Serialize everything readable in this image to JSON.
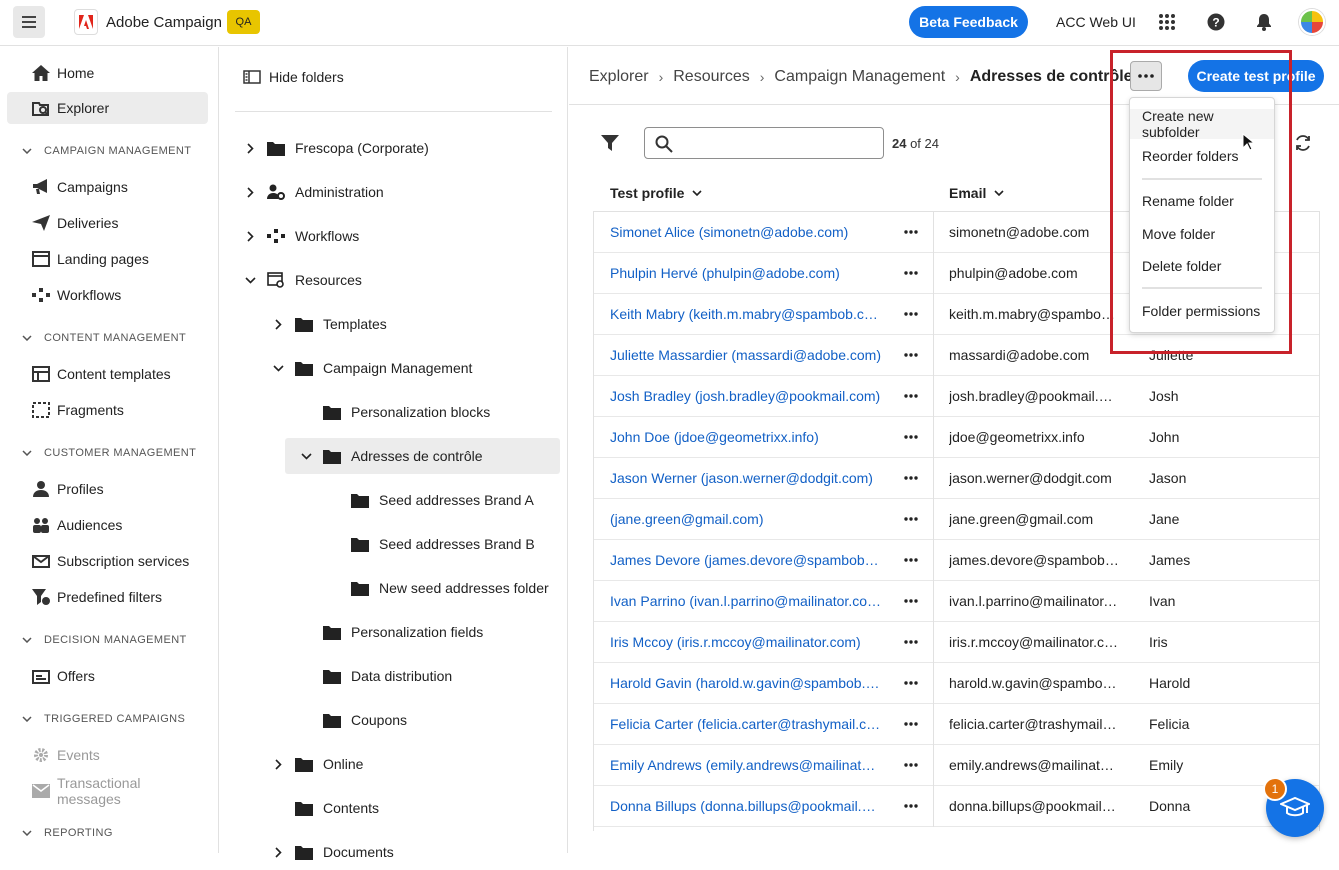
{
  "topbar": {
    "app_name": "Adobe Campaign",
    "env_badge": "QA",
    "beta_label": "Beta Feedback",
    "acc_web_label": "ACC Web UI",
    "icons": [
      "menu-icon",
      "adobe-logo-icon",
      "apps-grid-icon",
      "help-icon",
      "notifications-icon",
      "avatar"
    ]
  },
  "nav": {
    "home": "Home",
    "explorer": "Explorer",
    "sec_campaign": "CAMPAIGN MANAGEMENT",
    "campaigns": "Campaigns",
    "deliveries": "Deliveries",
    "landing_pages": "Landing pages",
    "workflows": "Workflows",
    "sec_content": "CONTENT MANAGEMENT",
    "content_templates": "Content templates",
    "fragments": "Fragments",
    "sec_customer": "CUSTOMER MANAGEMENT",
    "profiles": "Profiles",
    "audiences": "Audiences",
    "subscription_services": "Subscription services",
    "predefined_filters": "Predefined filters",
    "sec_decision": "DECISION MANAGEMENT",
    "offers": "Offers",
    "sec_triggered": "TRIGGERED CAMPAIGNS",
    "events": "Events",
    "transactional_messages": "Transactional messages",
    "sec_reporting": "REPORTING"
  },
  "tree": {
    "hide_folders": "Hide folders",
    "nodes": {
      "frescopa": "Frescopa (Corporate)",
      "administration": "Administration",
      "workflows": "Workflows",
      "resources": "Resources",
      "templates": "Templates",
      "campaign_management": "Campaign Management",
      "personalization_blocks": "Personalization blocks",
      "adresses": "Adresses de contrôle",
      "seed_a": "Seed addresses Brand A",
      "seed_b": "Seed addresses Brand B",
      "new_seed": "New seed addresses folder",
      "personalization_fields": "Personalization fields",
      "data_distribution": "Data distribution",
      "coupons": "Coupons",
      "online": "Online",
      "contents": "Contents",
      "documents": "Documents"
    }
  },
  "breadcrumb": {
    "items": [
      "Explorer",
      "Resources",
      "Campaign Management"
    ],
    "current": "Adresses de contrôle"
  },
  "actions": {
    "create_label": "Create test profile"
  },
  "search": {
    "placeholder": "",
    "count_bold": "24",
    "count_rest": " of 24"
  },
  "table": {
    "col_profile": "Test profile",
    "col_email": "Email",
    "rows": [
      {
        "profile": "Simonet Alice (simonetn@adobe.com)",
        "email": "simonetn@adobe.com",
        "first": ""
      },
      {
        "profile": "Phulpin Hervé (phulpin@adobe.com)",
        "email": "phulpin@adobe.com",
        "first": ""
      },
      {
        "profile": "Keith Mabry (keith.m.mabry@spambob.com)",
        "email": "keith.m.mabry@spambob.c...",
        "first": ""
      },
      {
        "profile": "Juliette Massardier (massardi@adobe.com)",
        "email": "massardi@adobe.com",
        "first": "Juliette"
      },
      {
        "profile": "Josh Bradley (josh.bradley@pookmail.com)",
        "email": "josh.bradley@pookmail.com",
        "first": "Josh"
      },
      {
        "profile": "John Doe (jdoe@geometrixx.info)",
        "email": "jdoe@geometrixx.info",
        "first": "John"
      },
      {
        "profile": "Jason Werner (jason.werner@dodgit.com)",
        "email": "jason.werner@dodgit.com",
        "first": "Jason"
      },
      {
        "profile": "(jane.green@gmail.com)",
        "email": "jane.green@gmail.com",
        "first": "Jane"
      },
      {
        "profile": "James Devore (james.devore@spambob.com)",
        "email": "james.devore@spambob.com",
        "first": "James"
      },
      {
        "profile": "Ivan Parrino (ivan.l.parrino@mailinator.com)",
        "email": "ivan.l.parrino@mailinator.c...",
        "first": "Ivan"
      },
      {
        "profile": "Iris Mccoy (iris.r.mccoy@mailinator.com)",
        "email": "iris.r.mccoy@mailinator.com",
        "first": "Iris"
      },
      {
        "profile": "Harold Gavin (harold.w.gavin@spambob.com)",
        "email": "harold.w.gavin@spambob.c...",
        "first": "Harold"
      },
      {
        "profile": "Felicia Carter (felicia.carter@trashymail.com)",
        "email": "felicia.carter@trashymail.com",
        "first": "Felicia"
      },
      {
        "profile": "Emily Andrews (emily.andrews@mailinator.c...",
        "email": "emily.andrews@mailinator....",
        "first": "Emily"
      },
      {
        "profile": "Donna Billups (donna.billups@pookmail.com)",
        "email": "donna.billups@pookmail.c...",
        "first": "Donna"
      }
    ]
  },
  "context_menu": {
    "items": [
      "Create new subfolder",
      "Reorder folders",
      "Rename folder",
      "Move folder",
      "Delete folder",
      "Folder permissions"
    ]
  },
  "help": {
    "badge_count": "1"
  },
  "colors": {
    "accent": "#1473e6",
    "link": "#1260c6",
    "highlight_box": "#c8222a",
    "qa_badge": "#e8c500",
    "notification_badge": "#e3720c"
  }
}
